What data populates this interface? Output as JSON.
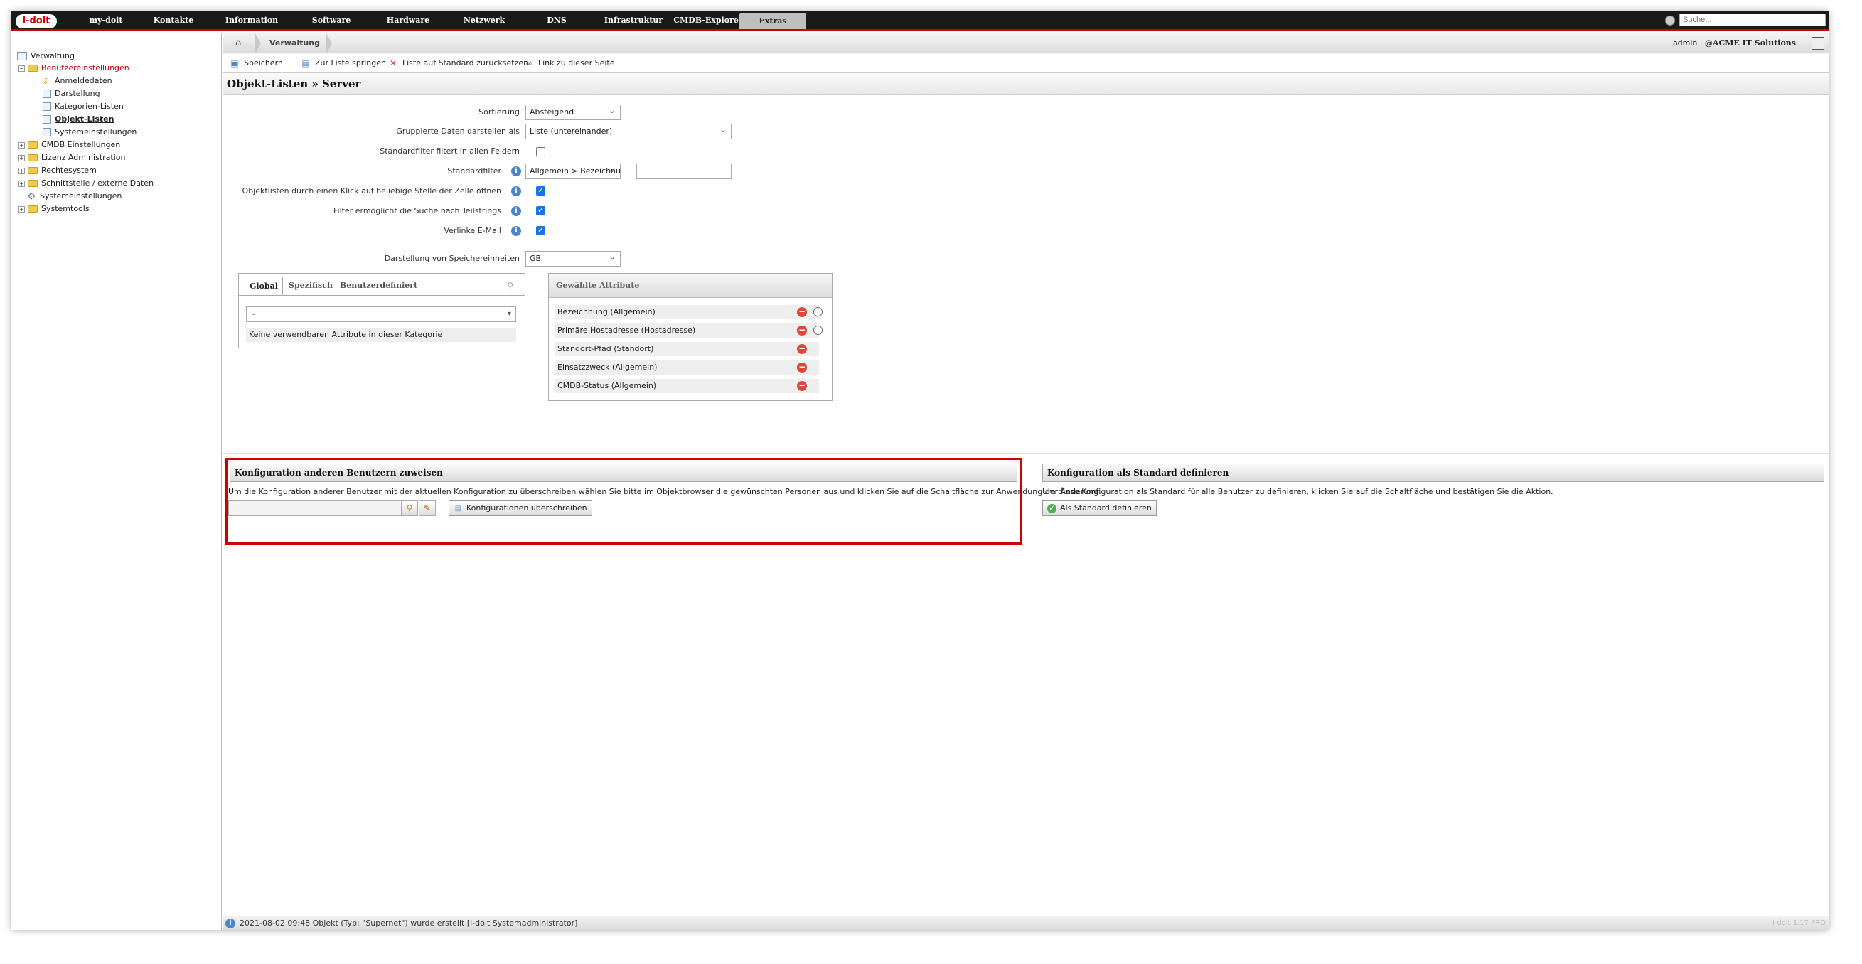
{
  "brand": {
    "logo_text": "i-doit"
  },
  "nav": {
    "items": [
      "my-doit",
      "Kontakte",
      "Information",
      "Software",
      "Hardware",
      "Netzwerk",
      "DNS",
      "Infrastruktur",
      "CMDB-Explorer",
      "Extras"
    ],
    "active": "Extras"
  },
  "search": {
    "placeholder": "Suche..."
  },
  "sidebar": {
    "root": "Verwaltung",
    "items": [
      {
        "label": "Benutzereinstellungen",
        "icon": "folder-icon",
        "expanded": true,
        "color": "#cc0000"
      },
      {
        "label": "Anmeldedaten",
        "icon": "key-icon"
      },
      {
        "label": "Darstellung",
        "icon": "page-icon"
      },
      {
        "label": "Kategorien-Listen",
        "icon": "page-icon"
      },
      {
        "label": "Objekt-Listen",
        "icon": "page-icon",
        "selected": true
      },
      {
        "label": "Systemeinstellungen",
        "icon": "list-icon"
      },
      {
        "label": "CMDB Einstellungen",
        "icon": "folder-icon"
      },
      {
        "label": "Lizenz Administration",
        "icon": "folder-icon"
      },
      {
        "label": "Rechtesystem",
        "icon": "folder-icon"
      },
      {
        "label": "Schnittstelle / externe Daten",
        "icon": "folder-icon"
      },
      {
        "label": "Systemeinstellungen",
        "icon": "gear-icon"
      },
      {
        "label": "Systemtools",
        "icon": "folder-icon"
      }
    ]
  },
  "breadcrumb": {
    "label": "Verwaltung"
  },
  "user": {
    "name": "admin",
    "org": "@ACME IT Solutions"
  },
  "toolbar": {
    "save": "Speichern",
    "to_list": "Zur Liste springen",
    "reset": "Liste auf Standard zurücksetzen",
    "link": "Link zu dieser Seite"
  },
  "page_title": "Objekt-Listen » Server",
  "form": {
    "sort_label": "Sortierung",
    "sort_value": "Absteigend",
    "group_label": "Gruppierte Daten darstellen als",
    "group_value": "Liste (untereinander)",
    "stdfilter_all_label": "Standardfilter filtert in allen Feldern",
    "stdfilter_all_checked": false,
    "stdfilter_label": "Standardfilter",
    "stdfilter_value": "Allgemein > Bezeichnung",
    "stdfilter_text": "",
    "click_label": "Objektlisten durch einen Klick auf beliebige Stelle der Zelle öffnen",
    "click_checked": true,
    "partial_label": "Filter ermöglicht die Suche nach Teilstrings",
    "partial_checked": true,
    "email_label": "Verlinke E-Mail",
    "email_checked": true,
    "storage_label": "Darstellung von Speichereinheiten",
    "storage_value": "GB"
  },
  "left_panel": {
    "tabs": [
      "Global",
      "Spezifisch",
      "Benutzerdefiniert"
    ],
    "active_tab": "Global",
    "category_value": "-",
    "empty_text": "Keine verwendbaren Attribute in dieser Kategorie"
  },
  "right_panel": {
    "title": "Gewählte Attribute",
    "attributes": [
      {
        "label": "Bezeichnung (Allgemein)",
        "has_radio": true
      },
      {
        "label": "Primäre Hostadresse (Hostadresse)",
        "has_radio": true
      },
      {
        "label": "Standort-Pfad (Standort)",
        "has_radio": false
      },
      {
        "label": "Einsatzzweck (Allgemein)",
        "has_radio": false
      },
      {
        "label": "CMDB-Status (Allgemein)",
        "has_radio": false
      }
    ]
  },
  "assign": {
    "title": "Konfiguration anderen Benutzern zuweisen",
    "description": "Um die Konfiguration anderer Benutzer mit der aktuellen Konfiguration zu überschreiben wählen Sie bitte im Objektbrowser die gewünschten Personen aus und klicken Sie auf die Schaltfläche zur Anwendung der Änderung.",
    "button": "Konfigurationen überschreiben"
  },
  "default": {
    "title": "Konfiguration als Standard definieren",
    "description": "Um diese Konfiguration als Standard für alle Benutzer zu definieren, klicken Sie auf die Schaltfläche und bestätigen Sie die Aktion.",
    "button": "Als Standard definieren"
  },
  "status": {
    "text": "2021-08-02 09:48 Objekt (Typ: \"Supernet\") wurde erstellt [i-doit Systemadministrator]",
    "version": "i-doit 1.17 PRO"
  },
  "colors": {
    "accent": "#cc0000",
    "nav_bg": "#1a1a1a",
    "highlight_box": "#d40000",
    "info": "#4a86c8",
    "remove": "#e0453a"
  }
}
